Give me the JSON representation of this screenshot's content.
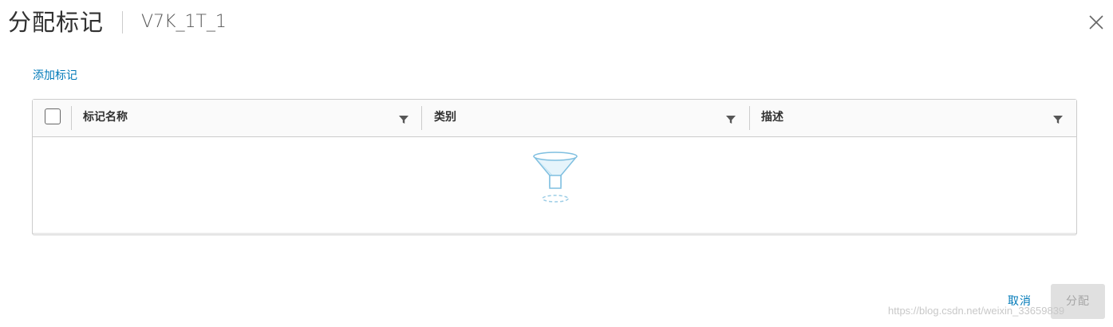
{
  "dialog": {
    "title": "分配标记",
    "subtitle": "V7K_1T_1",
    "close_icon": "close-icon"
  },
  "actions": {
    "add_tag_label": "添加标记"
  },
  "grid": {
    "columns": [
      {
        "label": "标记名称",
        "filter_icon": "filter-icon"
      },
      {
        "label": "类别",
        "filter_icon": "filter-icon"
      },
      {
        "label": "描述",
        "filter_icon": "filter-icon"
      }
    ],
    "rows": [],
    "empty_icon": "empty-funnel-icon",
    "select_all_checked": false
  },
  "footer": {
    "cancel_label": "取消",
    "assign_label": "分配",
    "assign_disabled": true
  },
  "watermark": "https://blog.csdn.net/weixin_33659839",
  "colors": {
    "link": "#0079b8",
    "border": "#cccccc",
    "disabled_bg": "#e0e0e0",
    "disabled_text": "#a6a6a6"
  }
}
